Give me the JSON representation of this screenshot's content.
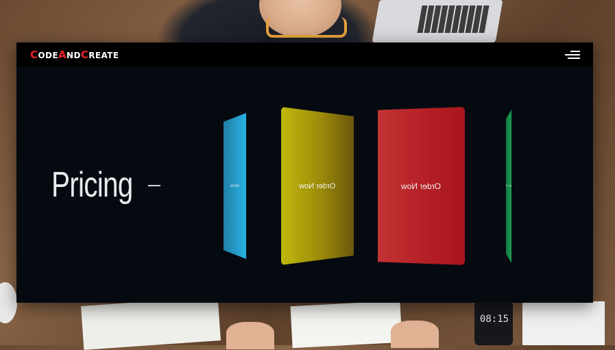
{
  "background": {
    "phone_time": "08:15"
  },
  "brand": {
    "segments": [
      {
        "cap": "C",
        "rest": "ODE"
      },
      {
        "cap": "A",
        "rest": "ND"
      },
      {
        "cap": "C",
        "rest": "REATE"
      }
    ],
    "accent_color": "#e8202a"
  },
  "nav": {
    "menu_icon": "hamburger-menu-icon"
  },
  "section": {
    "title": "Pricing"
  },
  "pricing_cards": [
    {
      "color": "#2ab2e2",
      "label": "Order Now"
    },
    {
      "color": "#bfb80d",
      "label": "Order Now"
    },
    {
      "color": "#c23333",
      "label": "Order Now"
    },
    {
      "color": "#1b9a55",
      "label": "Order Now"
    }
  ]
}
